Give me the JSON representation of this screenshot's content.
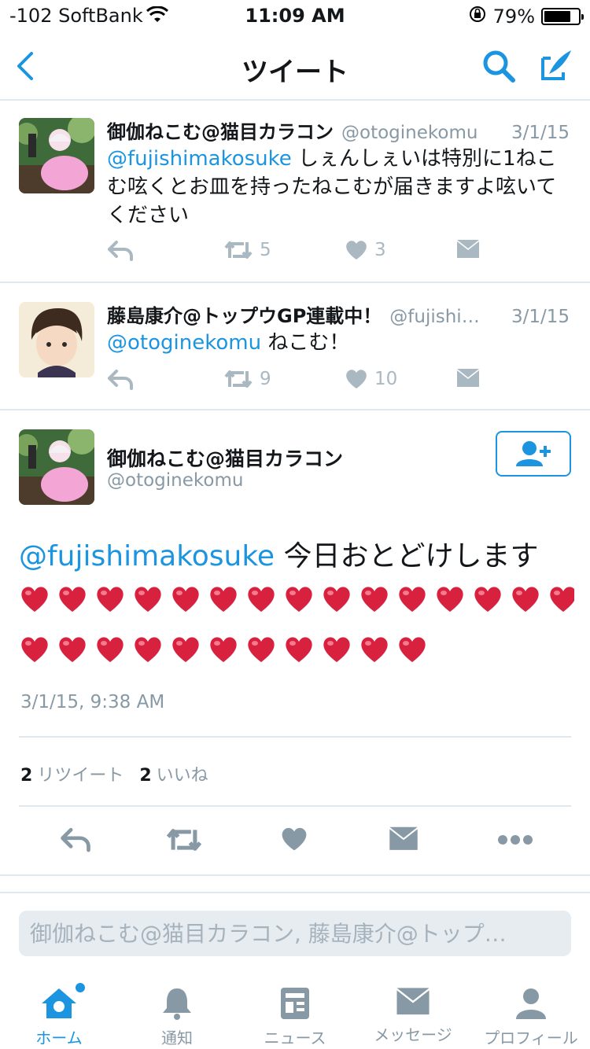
{
  "status_bar": {
    "carrier": "-102 SoftBank",
    "time": "11:09 AM",
    "battery": "79%",
    "battery_level": 0.79
  },
  "nav": {
    "title": "ツイート"
  },
  "tweets": [
    {
      "name": "御伽ねこむ@猫目カラコン",
      "handle": "@otoginekomu",
      "date": "3/1/15",
      "mention": "@fujishimakosuke",
      "text": " しぇんしぇいは特別に1ねこむ呟くとお皿を持ったねこむが届きますよ呟いてください",
      "retweets": "5",
      "likes": "3"
    },
    {
      "name": "藤島康介@トップウGP連載中！",
      "handle": "@fujishi…",
      "date": "3/1/15",
      "mention": "@otoginekomu",
      "text": " ねこむ！",
      "retweets": "9",
      "likes": "10"
    }
  ],
  "detail": {
    "name": "御伽ねこむ@猫目カラコン",
    "handle": "@otoginekomu",
    "mention": "@fujishimakosuke",
    "text": " 今日おとどけします",
    "timestamp": "3/1/15, 9:38 AM",
    "retweet_count": "2",
    "retweet_label": "リツイート",
    "like_count": "2",
    "like_label": "いいね"
  },
  "reply": {
    "placeholder": "御伽ねこむ@猫目カラコン, 藤島康介@トップ…"
  },
  "tabs": [
    {
      "label": "ホーム"
    },
    {
      "label": "通知"
    },
    {
      "label": "ニュース"
    },
    {
      "label": "メッセージ"
    },
    {
      "label": "プロフィール"
    }
  ],
  "colors": {
    "accent": "#1b95e0",
    "muted": "#8899a6",
    "icon_gray": "#aab8c2",
    "heart": "#e0245e"
  }
}
